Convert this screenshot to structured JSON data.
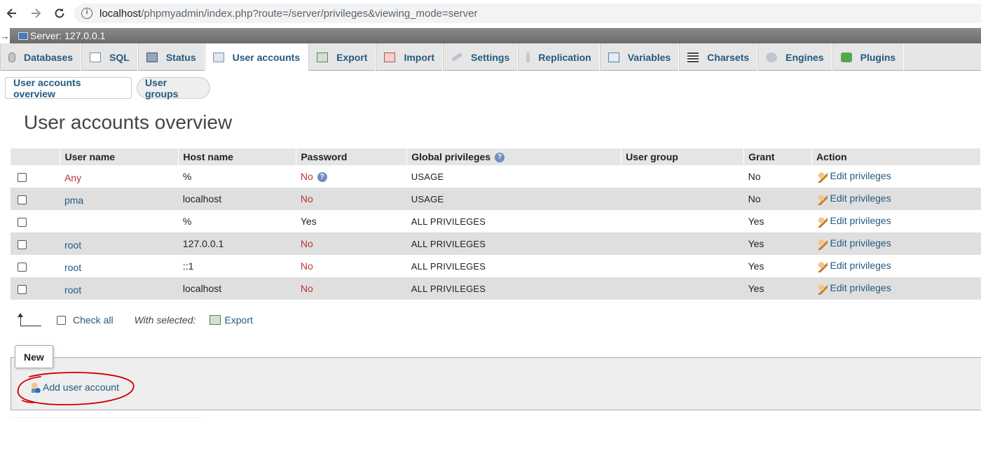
{
  "browser": {
    "url_host": "localhost",
    "url_path": "/phpmyadmin/index.php?route=/server/privileges&viewing_mode=server"
  },
  "server_bar": {
    "label": "Server: 127.0.0.1"
  },
  "tabs": [
    {
      "label": "Databases",
      "icon": "database-icon"
    },
    {
      "label": "SQL",
      "icon": "sql-icon"
    },
    {
      "label": "Status",
      "icon": "status-icon"
    },
    {
      "label": "User accounts",
      "icon": "user-accounts-icon",
      "active": true
    },
    {
      "label": "Export",
      "icon": "export-icon"
    },
    {
      "label": "Import",
      "icon": "import-icon"
    },
    {
      "label": "Settings",
      "icon": "settings-icon"
    },
    {
      "label": "Replication",
      "icon": "replication-icon"
    },
    {
      "label": "Variables",
      "icon": "variables-icon"
    },
    {
      "label": "Charsets",
      "icon": "charsets-icon"
    },
    {
      "label": "Engines",
      "icon": "engines-icon"
    },
    {
      "label": "Plugins",
      "icon": "plugins-icon"
    }
  ],
  "subtabs": {
    "overview": "User accounts overview",
    "groups": "User groups"
  },
  "page_title": "User accounts overview",
  "table": {
    "headers": [
      "User name",
      "Host name",
      "Password",
      "Global privileges",
      "User group",
      "Grant",
      "Action"
    ],
    "rows": [
      {
        "user": "Any",
        "host": "%",
        "password": "No",
        "privileges": "USAGE",
        "group": "",
        "grant": "No",
        "action": "Edit privileges"
      },
      {
        "user": "pma",
        "host": "localhost",
        "password": "No",
        "privileges": "USAGE",
        "group": "",
        "grant": "No",
        "action": "Edit privileges"
      },
      {
        "user": "",
        "host": "%",
        "password": "Yes",
        "privileges": "ALL PRIVILEGES",
        "group": "",
        "grant": "Yes",
        "action": "Edit privileges"
      },
      {
        "user": "root",
        "host": "127.0.0.1",
        "password": "No",
        "privileges": "ALL PRIVILEGES",
        "group": "",
        "grant": "Yes",
        "action": "Edit privileges"
      },
      {
        "user": "root",
        "host": "::1",
        "password": "No",
        "privileges": "ALL PRIVILEGES",
        "group": "",
        "grant": "Yes",
        "action": "Edit privileges"
      },
      {
        "user": "root",
        "host": "localhost",
        "password": "No",
        "privileges": "ALL PRIVILEGES",
        "group": "",
        "grant": "Yes",
        "action": "Edit privileges"
      }
    ]
  },
  "bulk": {
    "check_all": "Check all",
    "with_selected": "With selected:",
    "export": "Export"
  },
  "new_section": {
    "legend": "New",
    "add_user": "Add user account"
  },
  "colors": {
    "link": "#235a81",
    "no_red": "#bb3333",
    "annotation": "#cc0000"
  }
}
